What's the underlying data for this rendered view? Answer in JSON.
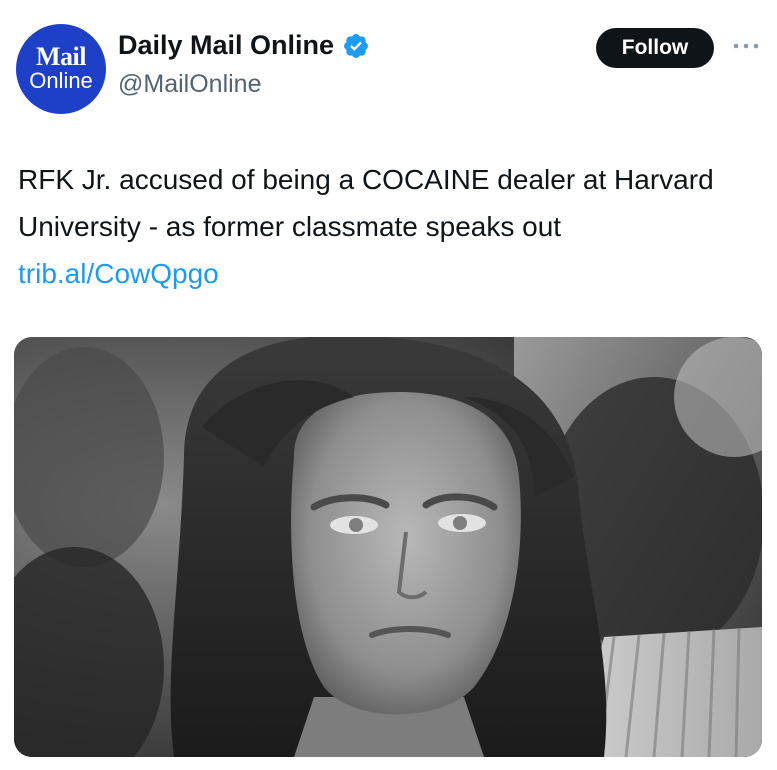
{
  "account": {
    "avatar_line1": "Mail",
    "avatar_line2": "Online",
    "display_name": "Daily Mail Online",
    "handle": "@MailOnline",
    "verified": true
  },
  "actions": {
    "follow_label": "Follow",
    "more_icon": "more-horizontal-icon"
  },
  "post": {
    "text": "RFK Jr. accused of being a COCAINE dealer at Harvard University - as former classmate speaks out ",
    "link_text": "trib.al/CowQpgo"
  },
  "colors": {
    "brand_blue": "#1d40c6",
    "verified_blue": "#1d9bf0",
    "link_blue": "#1d9bf0",
    "text": "#0f1419",
    "muted": "#536471",
    "button_bg": "#0f1419"
  },
  "media": {
    "kind": "black-and-white photo of a young man with long wavy hair"
  }
}
